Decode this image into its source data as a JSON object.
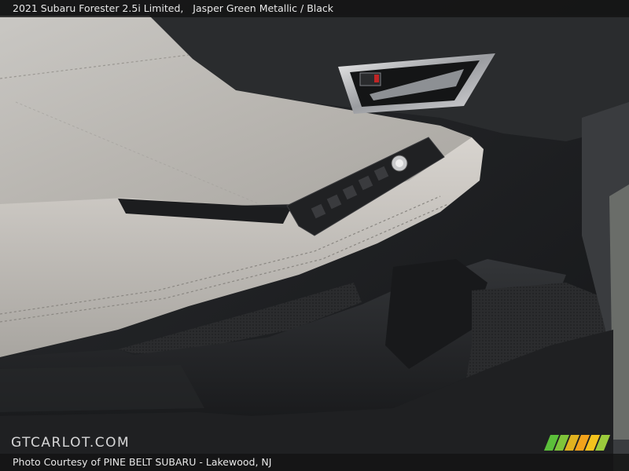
{
  "caption": {
    "vehicle": "2021 Subaru Forester 2.5i Limited,",
    "color": "Jasper Green Metallic / Black"
  },
  "watermark": {
    "logo_text": "GTCARLOT.COM"
  },
  "credit": {
    "prefix": "Photo Courtesy of",
    "dealer": "PINE BELT SUBARU",
    "separator": "-",
    "location": "Lakewood, NJ"
  },
  "brand_stripes": [
    "#5bbf3a",
    "#7fc43a",
    "#e0b21f",
    "#f2a31b",
    "#f3c21d",
    "#9bcb3c"
  ],
  "image_content": {
    "subject": "door-interior-panel",
    "icons": [
      "door-handle-icon",
      "window-switch-icon",
      "mirror-adjust-knob-icon",
      "speaker-grille-icon"
    ]
  }
}
